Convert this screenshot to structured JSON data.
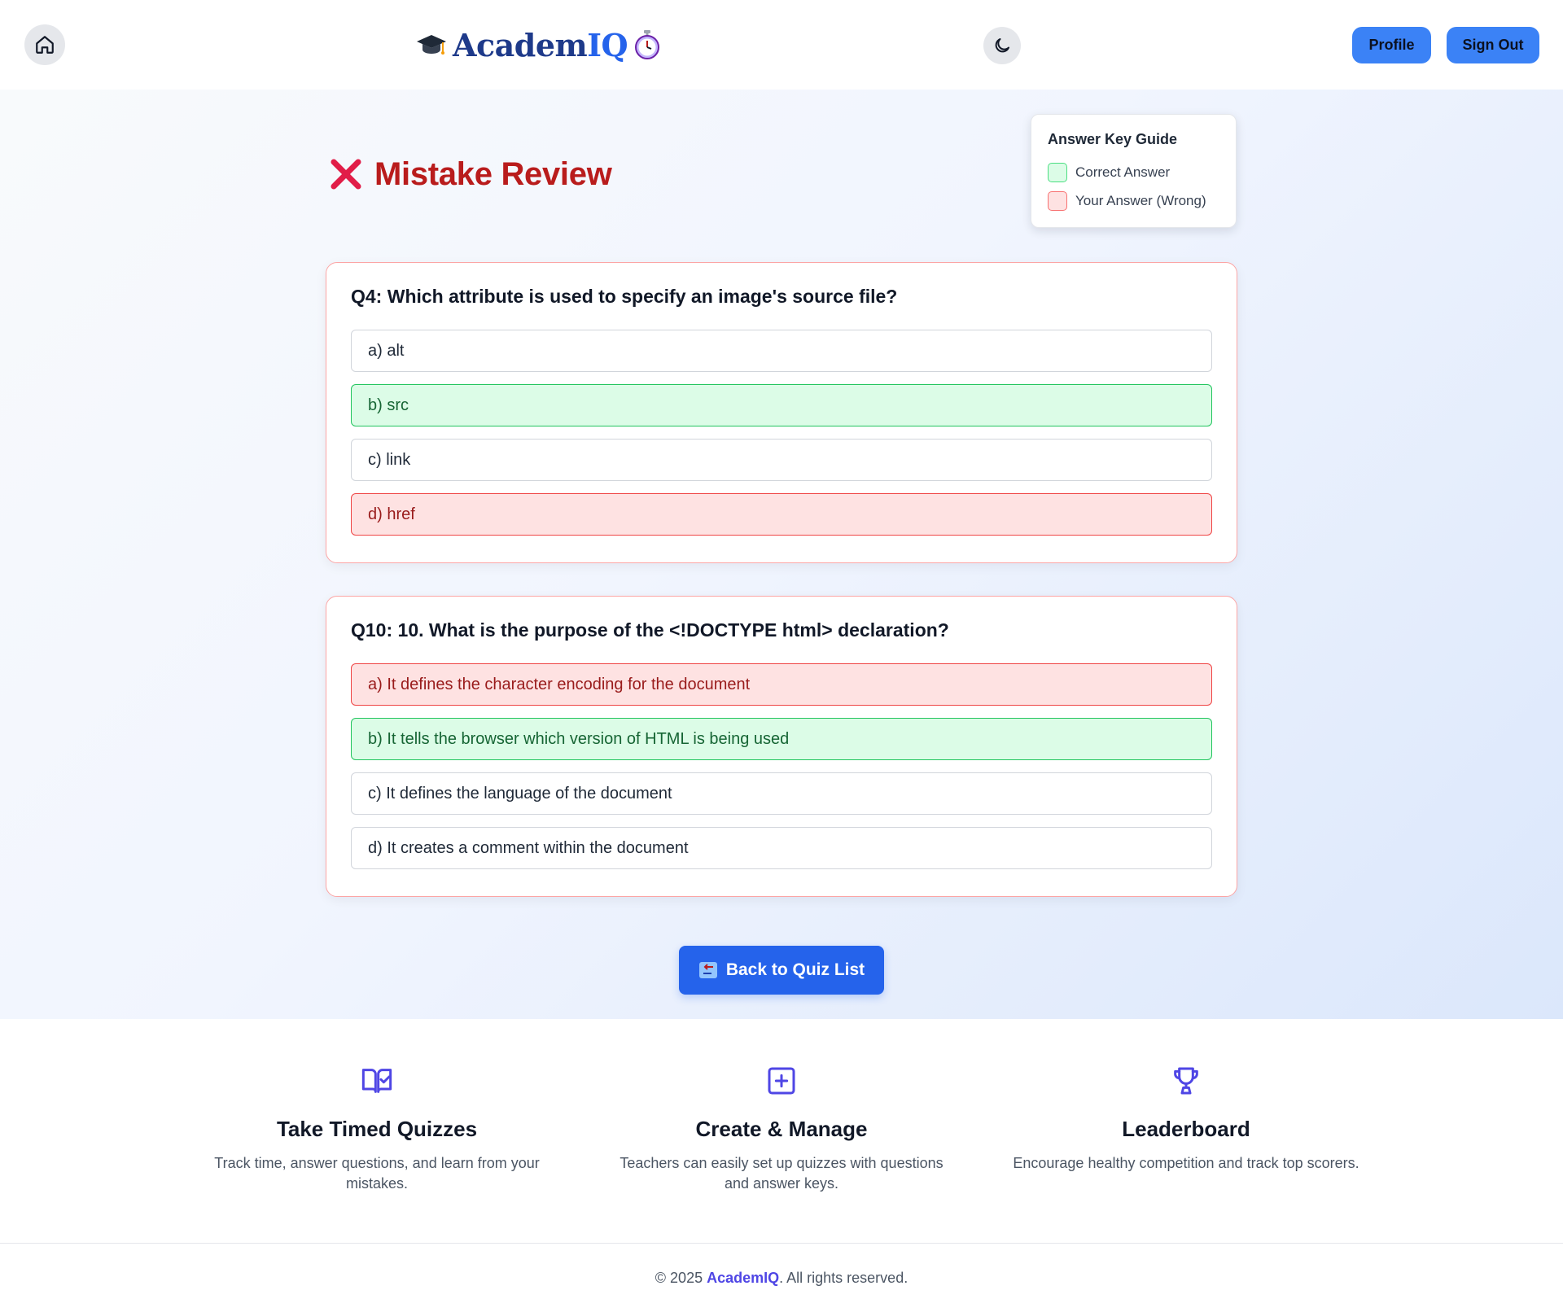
{
  "header": {
    "brand_prefix": "Academ",
    "brand_suffix": "IQ",
    "profile_label": "Profile",
    "signout_label": "Sign Out"
  },
  "page": {
    "title": "Mistake Review"
  },
  "legend": {
    "title": "Answer Key Guide",
    "correct_label": "Correct Answer",
    "wrong_label": "Your Answer (Wrong)"
  },
  "questions": [
    {
      "text": "Q4: Which attribute is used to specify an image's source file?",
      "options": [
        {
          "label": "a) alt",
          "status": "neutral"
        },
        {
          "label": "b) src",
          "status": "correct"
        },
        {
          "label": "c) link",
          "status": "neutral"
        },
        {
          "label": "d) href",
          "status": "wrong"
        }
      ]
    },
    {
      "text": "Q10: 10. What is the purpose of the <!DOCTYPE html> declaration?",
      "options": [
        {
          "label": "a) It defines the character encoding for the document",
          "status": "wrong"
        },
        {
          "label": "b) It tells the browser which version of HTML is being used",
          "status": "correct"
        },
        {
          "label": "c) It defines the language of the document",
          "status": "neutral"
        },
        {
          "label": "d) It creates a comment within the document",
          "status": "neutral"
        }
      ]
    }
  ],
  "back_button": {
    "label": "Back to Quiz List"
  },
  "features": [
    {
      "icon": "book-check-icon",
      "title": "Take Timed Quizzes",
      "description": "Track time, answer questions, and learn from your mistakes."
    },
    {
      "icon": "square-plus-icon",
      "title": "Create & Manage",
      "description": "Teachers can easily set up quizzes with questions and answer keys."
    },
    {
      "icon": "trophy-icon",
      "title": "Leaderboard",
      "description": "Encourage healthy competition and track top scorers."
    }
  ],
  "footer": {
    "prefix": "© 2025 ",
    "brand": "AcademIQ",
    "suffix": ". All rights reserved."
  },
  "colors": {
    "accent": "#3b82f6",
    "primary_button": "#2563eb",
    "title_red": "#b91c1c",
    "correct_bg": "#dcfce7",
    "wrong_bg": "#fee2e2",
    "feature_icon": "#4f46e5"
  }
}
